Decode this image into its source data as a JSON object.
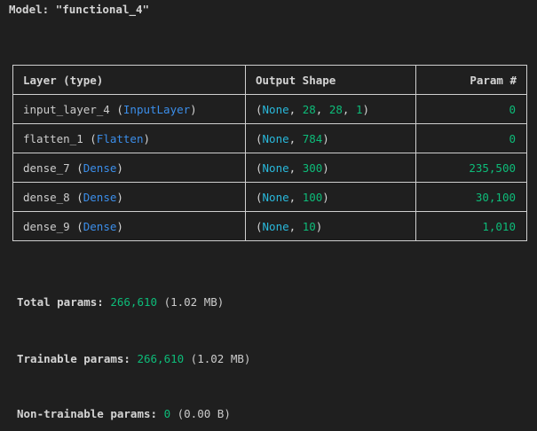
{
  "model": {
    "title_prefix": "Model: ",
    "title_name": "\"functional_4\""
  },
  "table": {
    "headers": [
      "Layer (type)",
      "Output Shape",
      "Param #"
    ],
    "rows": [
      {
        "name": "input_layer_4",
        "type": "InputLayer",
        "shape_none": "None",
        "shape_dims": [
          "28",
          "28",
          "1"
        ],
        "params": "0"
      },
      {
        "name": "flatten_1",
        "type": "Flatten",
        "shape_none": "None",
        "shape_dims": [
          "784"
        ],
        "params": "0"
      },
      {
        "name": "dense_7",
        "type": "Dense",
        "shape_none": "None",
        "shape_dims": [
          "300"
        ],
        "params": "235,500"
      },
      {
        "name": "dense_8",
        "type": "Dense",
        "shape_none": "None",
        "shape_dims": [
          "100"
        ],
        "params": "30,100"
      },
      {
        "name": "dense_9",
        "type": "Dense",
        "shape_none": "None",
        "shape_dims": [
          "10"
        ],
        "params": "1,010"
      }
    ]
  },
  "stats": {
    "total": {
      "label": "Total params: ",
      "value": "266,610",
      "size": " (1.02 MB)"
    },
    "trainable": {
      "label": "Trainable params: ",
      "value": "266,610",
      "size": " (1.02 MB)"
    },
    "non_trainable": {
      "label": "Non-trainable params: ",
      "value": "0",
      "size": " (0.00 B)"
    }
  },
  "colors": {
    "background": "#1f1f1f",
    "text": "#cccccc",
    "type_blue": "#3b8eea",
    "none_cyan": "#29b8db",
    "number_green": "#0dbc79",
    "border": "#cfcfcf"
  }
}
